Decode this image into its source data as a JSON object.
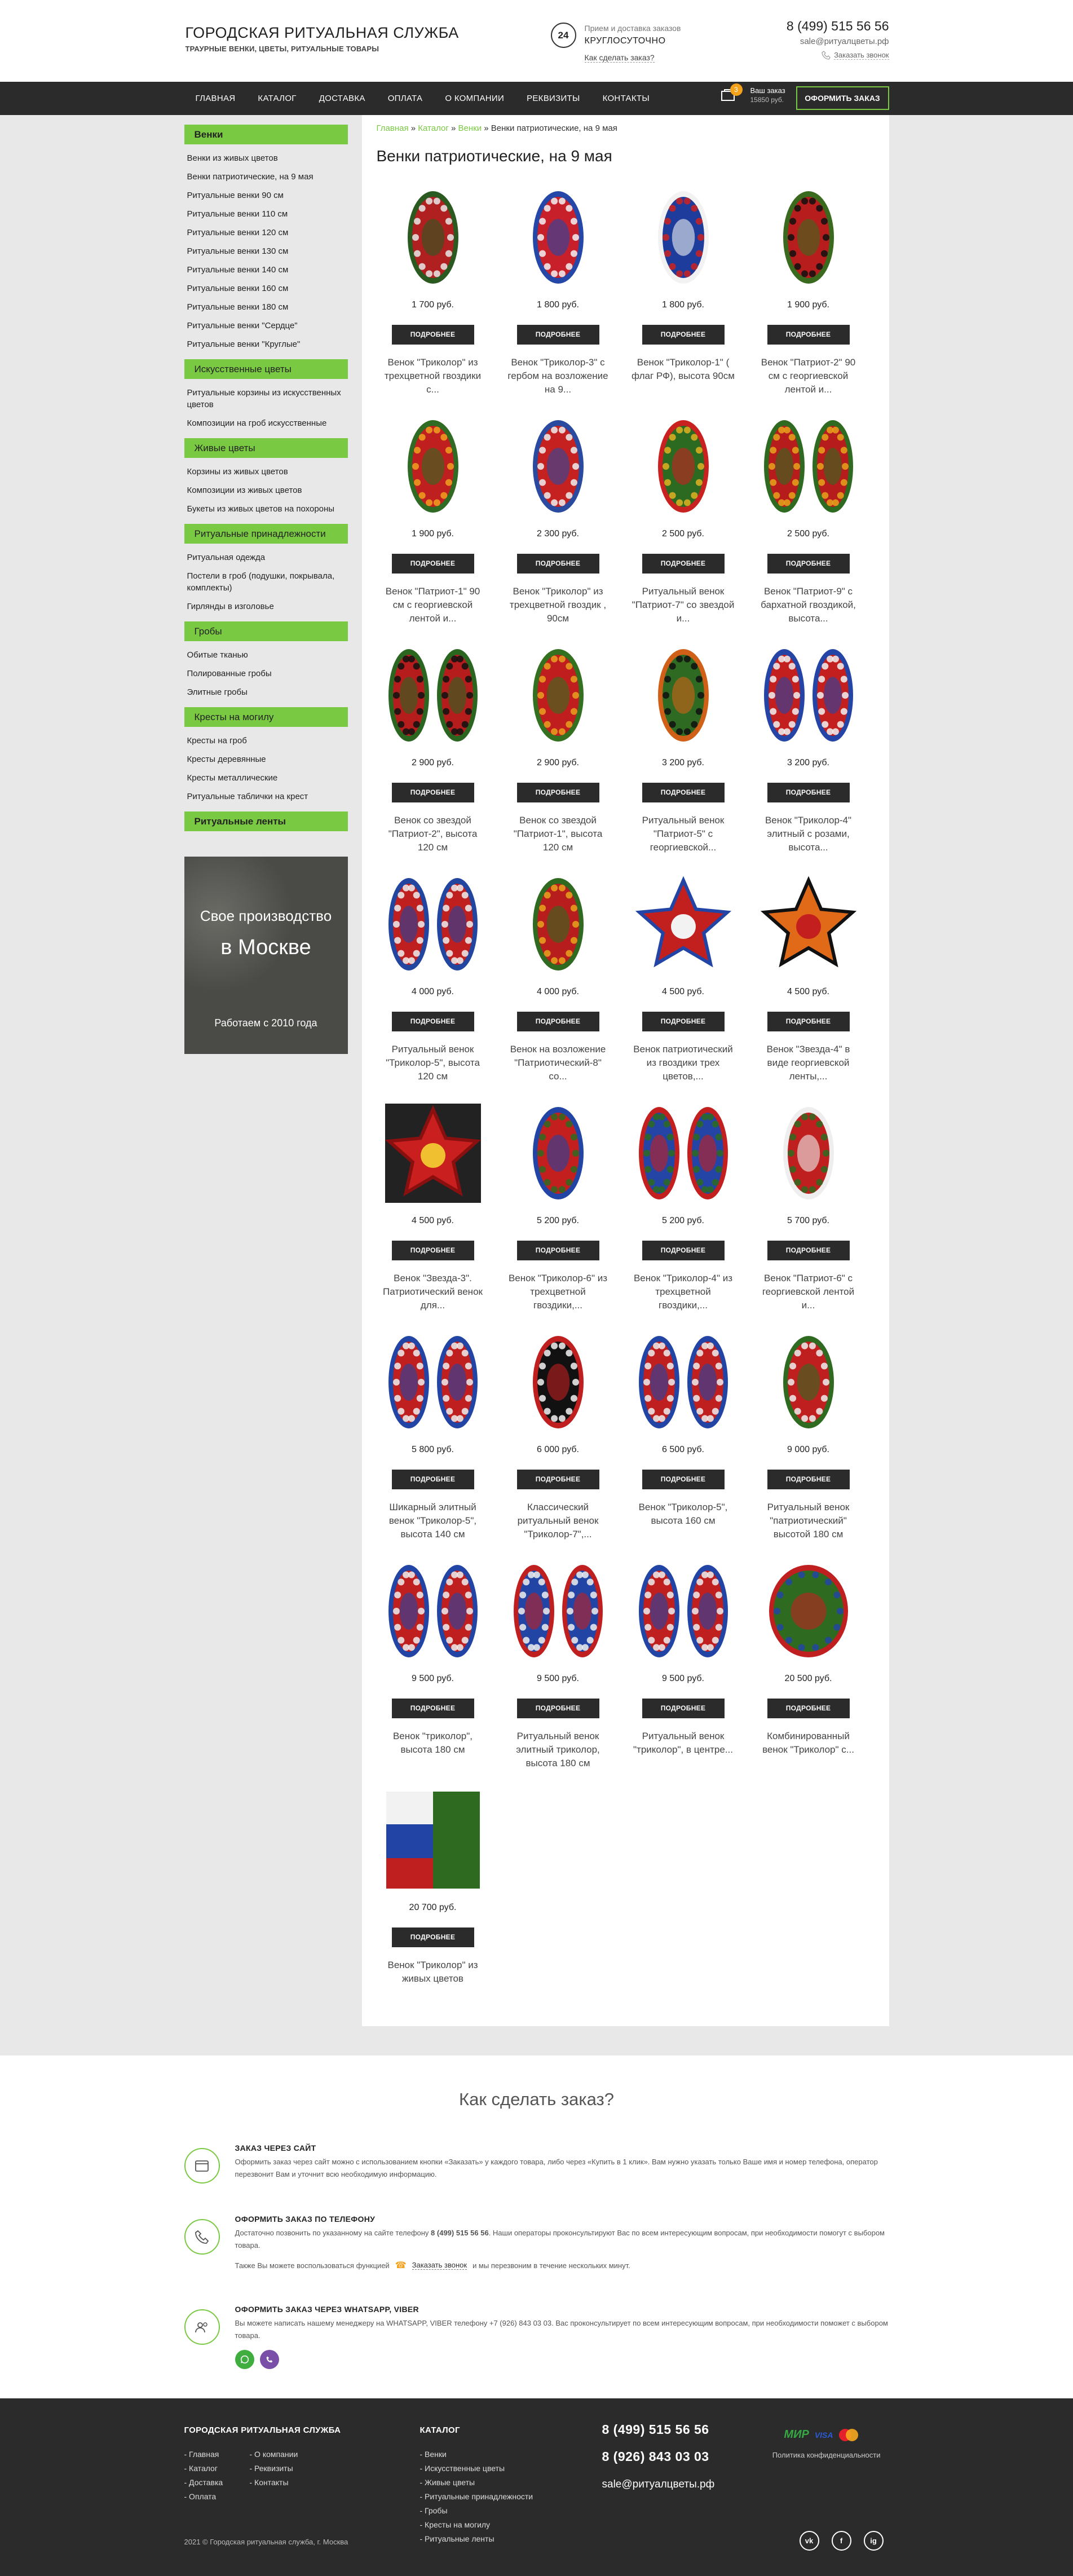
{
  "header": {
    "title": "ГОРОДСКАЯ РИТУАЛЬНАЯ СЛУЖБА",
    "subtitle": "ТРАУРНЫЕ ВЕНКИ, ЦВЕТЫ, РИТУАЛЬНЫЕ ТОВАРЫ",
    "badge24": "24",
    "accept": "Прием и доставка заказов",
    "round": "КРУГЛОСУТОЧНО",
    "how_link": "Как сделать заказ?",
    "phone": "8 (499) 515 56 56",
    "email": "sale@ритуалцветы.рф",
    "call_link": "Заказать звонок"
  },
  "nav": {
    "items": [
      "ГЛАВНАЯ",
      "КАТАЛОГ",
      "ДОСТАВКА",
      "ОПЛАТА",
      "О КОМПАНИИ",
      "РЕКВИЗИТЫ",
      "КОНТАКТЫ"
    ],
    "cart_count": "3",
    "cart_label": "Ваш заказ",
    "cart_sum": "15850 руб.",
    "order_button": "ОФОРМИТЬ ЗАКАЗ"
  },
  "sidebar": {
    "groups": [
      {
        "title": "Венки",
        "items": [
          "Венки из живых цветов",
          "Венки патриотические, на 9 мая",
          "Ритуальные венки 90 см",
          "Ритуальные венки 110 см",
          "Ритуальные венки 120 см",
          "Ритуальные венки 130 см",
          "Ритуальные венки 140 см",
          "Ритуальные венки 160 см",
          "Ритуальные венки 180 см",
          "Ритуальные венки \"Сердце\"",
          "Ритуальные венки \"Круглые\""
        ]
      },
      {
        "title": "Искусственные цветы",
        "items": [
          "Ритуальные корзины из искусственных цветов",
          "Композиции на гроб искусственные"
        ]
      },
      {
        "title": "Живые цветы",
        "items": [
          "Корзины из живых цветов",
          "Композиции из живых цветов",
          "Букеты из живых цветов на похороны"
        ]
      },
      {
        "title": "Ритуальные принадлежности",
        "items": [
          "Ритуальная одежда",
          "Постели в гроб (подушки, покрывала, комплекты)",
          "Гирлянды в изголовье"
        ]
      },
      {
        "title": "Гробы",
        "items": [
          "Обитые тканью",
          "Полированные гробы",
          "Элитные гробы"
        ]
      },
      {
        "title": "Кресты на могилу",
        "items": [
          "Кресты на гроб",
          "Кресты деревянные",
          "Кресты металлические",
          "Ритуальные таблички на крест"
        ]
      }
    ],
    "last_title": "Ритуальные ленты",
    "promo_line1": "Свое производство",
    "promo_line2": "в Москве",
    "promo_line3": "Работаем с 2010 года"
  },
  "content": {
    "breadcrumb": {
      "home": "Главная",
      "catalog": "Каталог",
      "wreaths": "Венки",
      "current": "Венки патриотические, на 9 мая",
      "sep": " » "
    },
    "title": "Венки патриотические, на 9 мая",
    "more_label": "ПОДРОБНЕЕ",
    "products": [
      {
        "price": "1 700 руб.",
        "name": "Венок \"Триколор\" из трехцветной гвоздики с...",
        "shape": "oval",
        "colors": [
          "#b02020",
          "#2a5a20",
          "#e8e8e8"
        ]
      },
      {
        "price": "1 800 руб.",
        "name": "Венок \"Триколор-3\" с гербом на возложение на 9...",
        "shape": "oval",
        "colors": [
          "#c8202a",
          "#2447a8",
          "#f2f2f2"
        ]
      },
      {
        "price": "1 800 руб.",
        "name": "Венок \"Триколор-1\" ( флаг РФ), высота 90см",
        "shape": "oval",
        "colors": [
          "#1d3c9c",
          "#f2f2f2",
          "#c22"
        ]
      },
      {
        "price": "1 900 руб.",
        "name": "Венок \"Патриот-2\" 90 см с георгиевской лентой и...",
        "shape": "oval",
        "colors": [
          "#b81d1d",
          "#3a6a1e",
          "#111"
        ]
      },
      {
        "price": "1 900 руб.",
        "name": "Венок \"Патриот-1\" 90 см с георгиевской лентой и...",
        "shape": "oval",
        "colors": [
          "#c01f1f",
          "#2f6b22",
          "#f0a020"
        ]
      },
      {
        "price": "2 300 руб.",
        "name": "Венок \"Триколор\" из трехцветной гвоздик , 90см",
        "shape": "oval",
        "colors": [
          "#c52121",
          "#2a4aa0",
          "#eee"
        ]
      },
      {
        "price": "2 500 руб.",
        "name": "Ритуальный венок \"Патриот-7\" со звездой и...",
        "shape": "oval",
        "colors": [
          "#2c6a22",
          "#c92020",
          "#e0b020"
        ]
      },
      {
        "price": "2 500 руб.",
        "name": "Венок \"Патриот-9\" с бархатной гвоздикой, высота...",
        "shape": "double",
        "colors": [
          "#b71c1c",
          "#2e6b20",
          "#e6a21c"
        ]
      },
      {
        "price": "2 900 руб.",
        "name": "Венок со звездой \"Патриот-2\", высота 120 см",
        "shape": "double",
        "colors": [
          "#b51d1d",
          "#2a6620",
          "#111"
        ]
      },
      {
        "price": "2 900 руб.",
        "name": "Венок со звездой \"Патриот-1\", высота 120 см",
        "shape": "oval",
        "colors": [
          "#c01e1e",
          "#33701f",
          "#e8a020"
        ]
      },
      {
        "price": "3 200 руб.",
        "name": "Ритуальный венок \"Патриот-5\" с георгиевской...",
        "shape": "oval",
        "colors": [
          "#2e6a22",
          "#d06018",
          "#111"
        ]
      },
      {
        "price": "3 200 руб.",
        "name": "Венок \"Триколор-4\" элитный с розами, высота...",
        "shape": "double",
        "colors": [
          "#c41f1f",
          "#2445a5",
          "#f2f2f2"
        ]
      },
      {
        "price": "4 000 руб.",
        "name": "Ритуальный венок \"Триколор-5\", высота 120 см",
        "shape": "double",
        "colors": [
          "#c01f1f",
          "#2245a0",
          "#eee"
        ]
      },
      {
        "price": "4 000 руб.",
        "name": "Венок на возложение \"Патриотический-8\" со...",
        "shape": "oval",
        "colors": [
          "#b81d1d",
          "#2f6a20",
          "#e6a21c"
        ]
      },
      {
        "price": "4 500 руб.",
        "name": "Венок патриотический из гвоздики трех цветов,...",
        "shape": "star",
        "colors": [
          "#c21f1f",
          "#2245a5",
          "#f2f2f2"
        ]
      },
      {
        "price": "4 500 руб.",
        "name": "Венок \"Звезда-4\" в виде георгиевской ленты,...",
        "shape": "star",
        "colors": [
          "#e06a18",
          "#111",
          "#c41f1f"
        ]
      },
      {
        "price": "4 500 руб.",
        "name": "Венок \"Звезда-3\". Патриотический венок для...",
        "shape": "star",
        "colors": [
          "#c91f1f",
          "#8a1010",
          "#f0c030"
        ]
      },
      {
        "price": "5 200 руб.",
        "name": "Венок \"Триколор-6\" из трехцветной гвоздики,...",
        "shape": "oval",
        "colors": [
          "#c41f1f",
          "#2245a5",
          "#2e6b20"
        ]
      },
      {
        "price": "5 200 руб.",
        "name": "Венок \"Триколор-4\" из трехцветной гвоздики,...",
        "shape": "double",
        "colors": [
          "#2445a5",
          "#c41f1f",
          "#2e6b20"
        ]
      },
      {
        "price": "5 700 руб.",
        "name": "Венок \"Патриот-6\" с георгиевской лентой и...",
        "shape": "oval",
        "colors": [
          "#c01f1f",
          "#eee",
          "#2e6b20"
        ]
      },
      {
        "price": "5 800 руб.",
        "name": "Шикарный элитный венок \"Триколор-5\", высота 140 см",
        "shape": "double",
        "colors": [
          "#c01f1f",
          "#2245a5",
          "#eee"
        ]
      },
      {
        "price": "6 000 руб.",
        "name": "Классический ритуальный венок \"Триколор-7\",...",
        "shape": "oval",
        "colors": [
          "#111",
          "#c01f1f",
          "#f2f2f2"
        ]
      },
      {
        "price": "6 500 руб.",
        "name": "Венок \"Триколор-5\", высота 160 см",
        "shape": "double",
        "colors": [
          "#c01f1f",
          "#2245a5",
          "#eee"
        ]
      },
      {
        "price": "9 000 руб.",
        "name": "Ритуальный венок \"патриотический\" высотой 180 см",
        "shape": "oval",
        "colors": [
          "#c01f1f",
          "#2e6b20",
          "#eee"
        ]
      },
      {
        "price": "9 500 руб.",
        "name": "Венок \"триколор\", высота 180 см",
        "shape": "double",
        "colors": [
          "#c01f1f",
          "#2245a5",
          "#eee"
        ]
      },
      {
        "price": "9 500 руб.",
        "name": "Ритуальный венок элитный триколор, высота 180 см",
        "shape": "double",
        "colors": [
          "#2245a5",
          "#c01f1f",
          "#eee"
        ]
      },
      {
        "price": "9 500 руб.",
        "name": "Ритуальный венок \"триколор\", в центре...",
        "shape": "double",
        "colors": [
          "#c01f1f",
          "#2245a5",
          "#eee"
        ]
      },
      {
        "price": "20 500 руб.",
        "name": "Комбинированный венок \"Триколор\" с...",
        "shape": "round",
        "colors": [
          "#2e6b20",
          "#c01f1f",
          "#2245a5"
        ]
      },
      {
        "price": "20 700 руб.",
        "name": "Венок \"Триколор\" из живых цветов",
        "shape": "square",
        "colors": [
          "#c01f1f",
          "#2245a5",
          "#f2f2f2"
        ]
      }
    ]
  },
  "how": {
    "title": "Как сделать заказ?",
    "site_h": "ЗАКАЗ ЧЕРЕЗ САЙТ",
    "site_p": "Оформить заказ через сайт можно с использованием кнопки «Заказать» у каждого товара, либо через «Купить в 1 клик». Вам нужно указать только Ваше имя и номер телефона, оператор перезвонит Вам и уточнит всю необходимую информацию.",
    "phone_h": "ОФОРМИТЬ ЗАКАЗ ПО ТЕЛЕФОНУ",
    "phone_p_pre": "Достаточно позвонить по указанному на сайте телефону ",
    "phone_p_num": "8 (499) 515 56 56",
    "phone_p_post": ". Наши операторы проконсультируют Вас по всем интересующим вопросам, при необходимости помогут с выбором товара.",
    "phone_p2_pre": "Также Вы можете воспользоваться функцией",
    "phone_p2_link": "Заказать звонок",
    "phone_p2_post": "и мы перезвоним в течение нескольких минут.",
    "wa_h": "ОФОРМИТЬ ЗАКАЗ ЧЕРЕЗ WHATSAPP, VIBER",
    "wa_p": "Вы можете написать нашему менеджеру на WHATSAPP, VIBER телефону +7 (926) 843 03 03. Вас проконсультирует по всем интересующим вопросам, при необходимости поможет с выбором товара."
  },
  "footer": {
    "brand": "ГОРОДСКАЯ РИТУАЛЬНАЯ СЛУЖБА",
    "col1": [
      "- Главная",
      "- Каталог",
      "- Доставка",
      "- Оплата"
    ],
    "col2": [
      "- О компании",
      "- Реквизиты",
      "- Контакты"
    ],
    "catalog_title": "КАТАЛОГ",
    "catalog": [
      "- Венки",
      "- Искусственные цветы",
      "- Живые цветы",
      "- Ритуальные принадлежности",
      "- Гробы",
      "- Кресты на могилу",
      "- Ритуальные ленты"
    ],
    "phone1": "8 (499) 515 56 56",
    "phone2": "8 (926) 843 03 03",
    "email": "sale@ритуалцветы.рф",
    "pay_mir": "МИР",
    "pay_visa": "VISA",
    "privacy": "Политика конфиденциальности",
    "copyright": "2021 © Городская ритуальная служба, г. Москва",
    "soc": [
      "vk",
      "f",
      "ig"
    ]
  }
}
